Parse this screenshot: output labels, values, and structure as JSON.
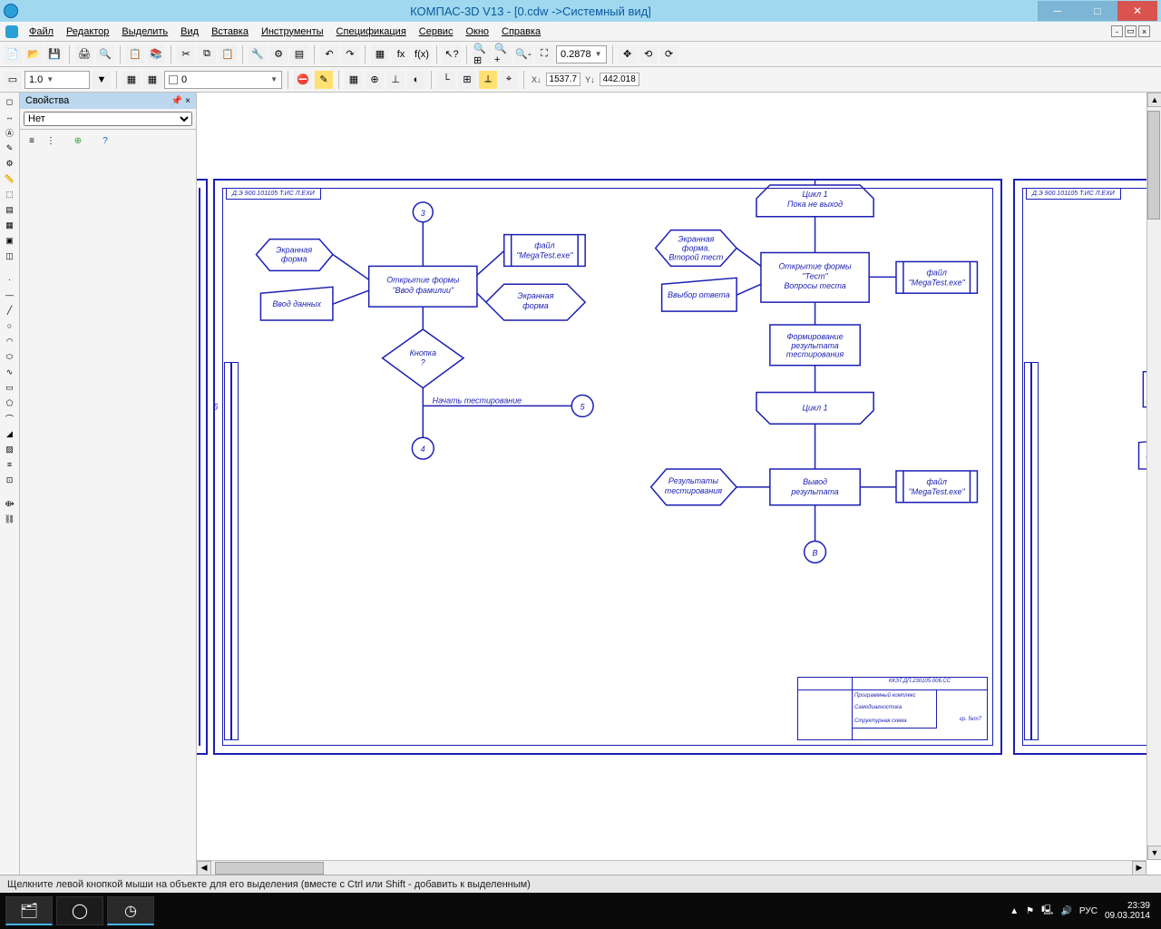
{
  "titlebar": {
    "text": "КОМПАС-3D V13 - [0.cdw ->Системный вид]"
  },
  "menu": {
    "items": [
      "Файл",
      "Редактор",
      "Выделить",
      "Вид",
      "Вставка",
      "Инструменты",
      "Спецификация",
      "Сервис",
      "Окно",
      "Справка"
    ]
  },
  "toolbar2": {
    "scale": "1.0",
    "layer": "0",
    "zoom": "0.2878",
    "coord_x": "1537.7",
    "coord_y": "442.018"
  },
  "properties": {
    "title": "Свойства",
    "dropdown": "Нет"
  },
  "flow": {
    "sheet1_ref": "Д.Э 900.101105 Т.ИС Л.ЕХИ",
    "connector_3": "3",
    "connector_5a": "5",
    "connector_5b": "5",
    "connector_4": "4",
    "connector_B": "В",
    "screen_form1": "Экранная\nформа",
    "input_data": "Ввод данных",
    "open_form1": "Открытие формы\n\"Ввод фамилии\"",
    "file_mega1": "файл\n\"MegaTest.exe\"",
    "screen_form2": "Экранная\nформа",
    "button_q": "Кнопка\n?",
    "start_test": "Начать тестирование",
    "screen_form3": "Экранная\nформа.\nВторой тест",
    "choose_answer": "Ввыбор ответа",
    "cycle1_head": "Цикл 1\nПока не выход",
    "open_form2": "Открытие формы\n\"Тест\"\nВопросы теста",
    "file_mega2": "файл\n\"MegaTest.exe\"",
    "form_result": "Формирование\nрезультата\nтестирования",
    "cycle1_end": "Цикл 1",
    "results": "Результаты\nтестирования",
    "output_result": "Вывод\nрезультата",
    "file_mega3": "файл\n\"MegaTest.exe\"",
    "titleblock_id": "ККЭТ.ДП.230105.006.СС",
    "titleblock_r1": "Программный комплекс",
    "titleblock_r2": "Самодиагностика",
    "titleblock_r3": "Структурная схема",
    "titleblock_r4": "гр. 5кт7",
    "partial_1": "Э",
    "partial_2": "Вы"
  },
  "status": {
    "hint": "Щелкните левой кнопкой мыши на объекте для его выделения (вместе с Ctrl или Shift - добавить к выделенным)"
  },
  "tray": {
    "lang": "РУС",
    "time": "23:39",
    "date": "09.03.2014"
  }
}
